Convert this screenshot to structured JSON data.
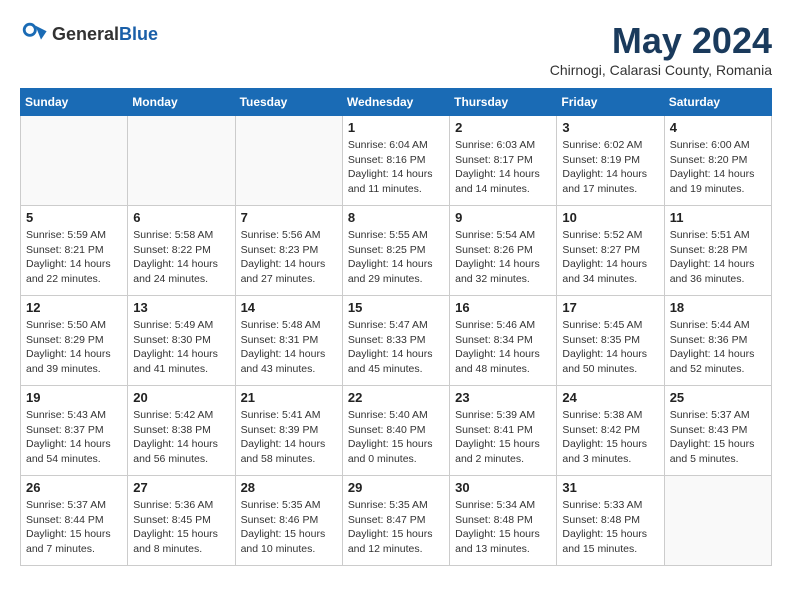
{
  "header": {
    "logo_general": "General",
    "logo_blue": "Blue",
    "month_title": "May 2024",
    "location": "Chirnogi, Calarasi County, Romania"
  },
  "weekdays": [
    "Sunday",
    "Monday",
    "Tuesday",
    "Wednesday",
    "Thursday",
    "Friday",
    "Saturday"
  ],
  "weeks": [
    [
      {
        "day": "",
        "info": ""
      },
      {
        "day": "",
        "info": ""
      },
      {
        "day": "",
        "info": ""
      },
      {
        "day": "1",
        "info": "Sunrise: 6:04 AM\nSunset: 8:16 PM\nDaylight: 14 hours\nand 11 minutes."
      },
      {
        "day": "2",
        "info": "Sunrise: 6:03 AM\nSunset: 8:17 PM\nDaylight: 14 hours\nand 14 minutes."
      },
      {
        "day": "3",
        "info": "Sunrise: 6:02 AM\nSunset: 8:19 PM\nDaylight: 14 hours\nand 17 minutes."
      },
      {
        "day": "4",
        "info": "Sunrise: 6:00 AM\nSunset: 8:20 PM\nDaylight: 14 hours\nand 19 minutes."
      }
    ],
    [
      {
        "day": "5",
        "info": "Sunrise: 5:59 AM\nSunset: 8:21 PM\nDaylight: 14 hours\nand 22 minutes."
      },
      {
        "day": "6",
        "info": "Sunrise: 5:58 AM\nSunset: 8:22 PM\nDaylight: 14 hours\nand 24 minutes."
      },
      {
        "day": "7",
        "info": "Sunrise: 5:56 AM\nSunset: 8:23 PM\nDaylight: 14 hours\nand 27 minutes."
      },
      {
        "day": "8",
        "info": "Sunrise: 5:55 AM\nSunset: 8:25 PM\nDaylight: 14 hours\nand 29 minutes."
      },
      {
        "day": "9",
        "info": "Sunrise: 5:54 AM\nSunset: 8:26 PM\nDaylight: 14 hours\nand 32 minutes."
      },
      {
        "day": "10",
        "info": "Sunrise: 5:52 AM\nSunset: 8:27 PM\nDaylight: 14 hours\nand 34 minutes."
      },
      {
        "day": "11",
        "info": "Sunrise: 5:51 AM\nSunset: 8:28 PM\nDaylight: 14 hours\nand 36 minutes."
      }
    ],
    [
      {
        "day": "12",
        "info": "Sunrise: 5:50 AM\nSunset: 8:29 PM\nDaylight: 14 hours\nand 39 minutes."
      },
      {
        "day": "13",
        "info": "Sunrise: 5:49 AM\nSunset: 8:30 PM\nDaylight: 14 hours\nand 41 minutes."
      },
      {
        "day": "14",
        "info": "Sunrise: 5:48 AM\nSunset: 8:31 PM\nDaylight: 14 hours\nand 43 minutes."
      },
      {
        "day": "15",
        "info": "Sunrise: 5:47 AM\nSunset: 8:33 PM\nDaylight: 14 hours\nand 45 minutes."
      },
      {
        "day": "16",
        "info": "Sunrise: 5:46 AM\nSunset: 8:34 PM\nDaylight: 14 hours\nand 48 minutes."
      },
      {
        "day": "17",
        "info": "Sunrise: 5:45 AM\nSunset: 8:35 PM\nDaylight: 14 hours\nand 50 minutes."
      },
      {
        "day": "18",
        "info": "Sunrise: 5:44 AM\nSunset: 8:36 PM\nDaylight: 14 hours\nand 52 minutes."
      }
    ],
    [
      {
        "day": "19",
        "info": "Sunrise: 5:43 AM\nSunset: 8:37 PM\nDaylight: 14 hours\nand 54 minutes."
      },
      {
        "day": "20",
        "info": "Sunrise: 5:42 AM\nSunset: 8:38 PM\nDaylight: 14 hours\nand 56 minutes."
      },
      {
        "day": "21",
        "info": "Sunrise: 5:41 AM\nSunset: 8:39 PM\nDaylight: 14 hours\nand 58 minutes."
      },
      {
        "day": "22",
        "info": "Sunrise: 5:40 AM\nSunset: 8:40 PM\nDaylight: 15 hours\nand 0 minutes."
      },
      {
        "day": "23",
        "info": "Sunrise: 5:39 AM\nSunset: 8:41 PM\nDaylight: 15 hours\nand 2 minutes."
      },
      {
        "day": "24",
        "info": "Sunrise: 5:38 AM\nSunset: 8:42 PM\nDaylight: 15 hours\nand 3 minutes."
      },
      {
        "day": "25",
        "info": "Sunrise: 5:37 AM\nSunset: 8:43 PM\nDaylight: 15 hours\nand 5 minutes."
      }
    ],
    [
      {
        "day": "26",
        "info": "Sunrise: 5:37 AM\nSunset: 8:44 PM\nDaylight: 15 hours\nand 7 minutes."
      },
      {
        "day": "27",
        "info": "Sunrise: 5:36 AM\nSunset: 8:45 PM\nDaylight: 15 hours\nand 8 minutes."
      },
      {
        "day": "28",
        "info": "Sunrise: 5:35 AM\nSunset: 8:46 PM\nDaylight: 15 hours\nand 10 minutes."
      },
      {
        "day": "29",
        "info": "Sunrise: 5:35 AM\nSunset: 8:47 PM\nDaylight: 15 hours\nand 12 minutes."
      },
      {
        "day": "30",
        "info": "Sunrise: 5:34 AM\nSunset: 8:48 PM\nDaylight: 15 hours\nand 13 minutes."
      },
      {
        "day": "31",
        "info": "Sunrise: 5:33 AM\nSunset: 8:48 PM\nDaylight: 15 hours\nand 15 minutes."
      },
      {
        "day": "",
        "info": ""
      }
    ]
  ]
}
